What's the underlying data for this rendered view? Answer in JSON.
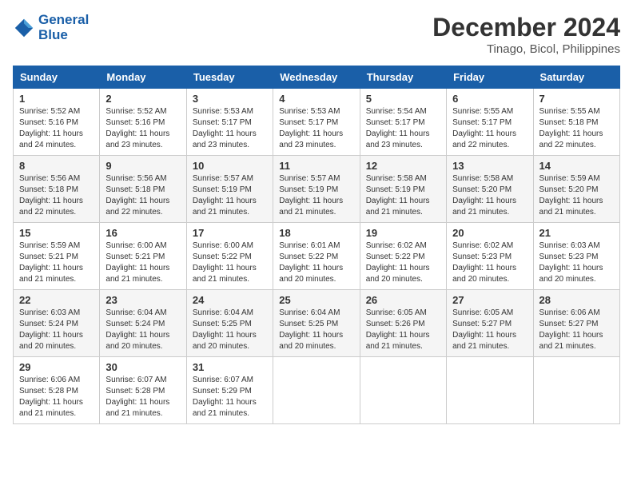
{
  "header": {
    "logo_line1": "General",
    "logo_line2": "Blue",
    "month_year": "December 2024",
    "location": "Tinago, Bicol, Philippines"
  },
  "weekdays": [
    "Sunday",
    "Monday",
    "Tuesday",
    "Wednesday",
    "Thursday",
    "Friday",
    "Saturday"
  ],
  "weeks": [
    [
      {
        "day": "1",
        "info": "Sunrise: 5:52 AM\nSunset: 5:16 PM\nDaylight: 11 hours\nand 24 minutes."
      },
      {
        "day": "2",
        "info": "Sunrise: 5:52 AM\nSunset: 5:16 PM\nDaylight: 11 hours\nand 23 minutes."
      },
      {
        "day": "3",
        "info": "Sunrise: 5:53 AM\nSunset: 5:17 PM\nDaylight: 11 hours\nand 23 minutes."
      },
      {
        "day": "4",
        "info": "Sunrise: 5:53 AM\nSunset: 5:17 PM\nDaylight: 11 hours\nand 23 minutes."
      },
      {
        "day": "5",
        "info": "Sunrise: 5:54 AM\nSunset: 5:17 PM\nDaylight: 11 hours\nand 23 minutes."
      },
      {
        "day": "6",
        "info": "Sunrise: 5:55 AM\nSunset: 5:17 PM\nDaylight: 11 hours\nand 22 minutes."
      },
      {
        "day": "7",
        "info": "Sunrise: 5:55 AM\nSunset: 5:18 PM\nDaylight: 11 hours\nand 22 minutes."
      }
    ],
    [
      {
        "day": "8",
        "info": "Sunrise: 5:56 AM\nSunset: 5:18 PM\nDaylight: 11 hours\nand 22 minutes."
      },
      {
        "day": "9",
        "info": "Sunrise: 5:56 AM\nSunset: 5:18 PM\nDaylight: 11 hours\nand 22 minutes."
      },
      {
        "day": "10",
        "info": "Sunrise: 5:57 AM\nSunset: 5:19 PM\nDaylight: 11 hours\nand 21 minutes."
      },
      {
        "day": "11",
        "info": "Sunrise: 5:57 AM\nSunset: 5:19 PM\nDaylight: 11 hours\nand 21 minutes."
      },
      {
        "day": "12",
        "info": "Sunrise: 5:58 AM\nSunset: 5:19 PM\nDaylight: 11 hours\nand 21 minutes."
      },
      {
        "day": "13",
        "info": "Sunrise: 5:58 AM\nSunset: 5:20 PM\nDaylight: 11 hours\nand 21 minutes."
      },
      {
        "day": "14",
        "info": "Sunrise: 5:59 AM\nSunset: 5:20 PM\nDaylight: 11 hours\nand 21 minutes."
      }
    ],
    [
      {
        "day": "15",
        "info": "Sunrise: 5:59 AM\nSunset: 5:21 PM\nDaylight: 11 hours\nand 21 minutes."
      },
      {
        "day": "16",
        "info": "Sunrise: 6:00 AM\nSunset: 5:21 PM\nDaylight: 11 hours\nand 21 minutes."
      },
      {
        "day": "17",
        "info": "Sunrise: 6:00 AM\nSunset: 5:22 PM\nDaylight: 11 hours\nand 21 minutes."
      },
      {
        "day": "18",
        "info": "Sunrise: 6:01 AM\nSunset: 5:22 PM\nDaylight: 11 hours\nand 20 minutes."
      },
      {
        "day": "19",
        "info": "Sunrise: 6:02 AM\nSunset: 5:22 PM\nDaylight: 11 hours\nand 20 minutes."
      },
      {
        "day": "20",
        "info": "Sunrise: 6:02 AM\nSunset: 5:23 PM\nDaylight: 11 hours\nand 20 minutes."
      },
      {
        "day": "21",
        "info": "Sunrise: 6:03 AM\nSunset: 5:23 PM\nDaylight: 11 hours\nand 20 minutes."
      }
    ],
    [
      {
        "day": "22",
        "info": "Sunrise: 6:03 AM\nSunset: 5:24 PM\nDaylight: 11 hours\nand 20 minutes."
      },
      {
        "day": "23",
        "info": "Sunrise: 6:04 AM\nSunset: 5:24 PM\nDaylight: 11 hours\nand 20 minutes."
      },
      {
        "day": "24",
        "info": "Sunrise: 6:04 AM\nSunset: 5:25 PM\nDaylight: 11 hours\nand 20 minutes."
      },
      {
        "day": "25",
        "info": "Sunrise: 6:04 AM\nSunset: 5:25 PM\nDaylight: 11 hours\nand 20 minutes."
      },
      {
        "day": "26",
        "info": "Sunrise: 6:05 AM\nSunset: 5:26 PM\nDaylight: 11 hours\nand 21 minutes."
      },
      {
        "day": "27",
        "info": "Sunrise: 6:05 AM\nSunset: 5:27 PM\nDaylight: 11 hours\nand 21 minutes."
      },
      {
        "day": "28",
        "info": "Sunrise: 6:06 AM\nSunset: 5:27 PM\nDaylight: 11 hours\nand 21 minutes."
      }
    ],
    [
      {
        "day": "29",
        "info": "Sunrise: 6:06 AM\nSunset: 5:28 PM\nDaylight: 11 hours\nand 21 minutes."
      },
      {
        "day": "30",
        "info": "Sunrise: 6:07 AM\nSunset: 5:28 PM\nDaylight: 11 hours\nand 21 minutes."
      },
      {
        "day": "31",
        "info": "Sunrise: 6:07 AM\nSunset: 5:29 PM\nDaylight: 11 hours\nand 21 minutes."
      },
      {
        "day": "",
        "info": ""
      },
      {
        "day": "",
        "info": ""
      },
      {
        "day": "",
        "info": ""
      },
      {
        "day": "",
        "info": ""
      }
    ]
  ]
}
